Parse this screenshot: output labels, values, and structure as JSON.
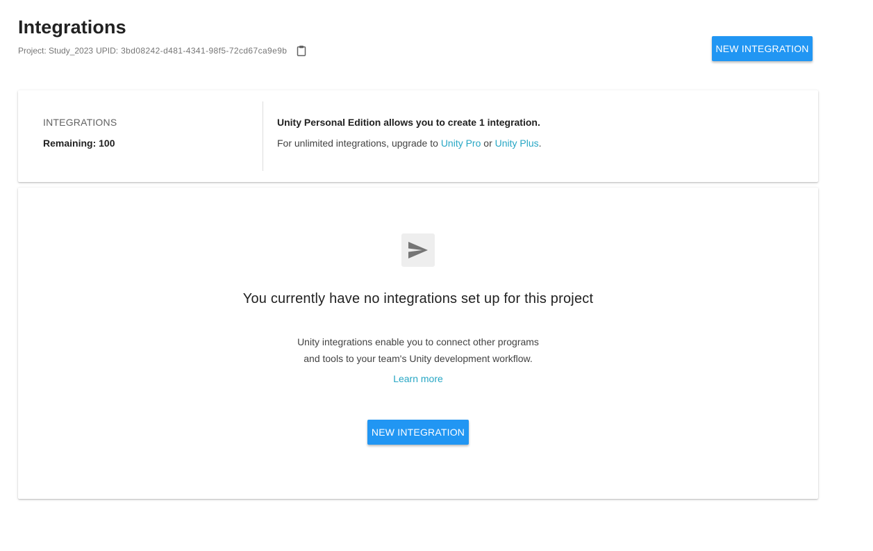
{
  "header": {
    "title": "Integrations",
    "project_label": "Project: Study_2023",
    "upid_label": "UPID:",
    "upid_value": "3bd08242-d481-4341-98f5-72cd67ca9e9b",
    "copy_icon": "clipboard-icon",
    "new_integration_label": "NEW INTEGRATION"
  },
  "summary": {
    "label": "INTEGRATIONS",
    "remaining": "Remaining: 100",
    "edition_text": "Unity Personal Edition allows you to create 1 integration.",
    "upgrade_prefix": "For unlimited integrations, upgrade to",
    "upgrade_pro": "Unity Pro",
    "upgrade_or": "or",
    "upgrade_plus": "Unity Plus",
    "upgrade_suffix": "."
  },
  "empty_state": {
    "icon": "send-icon",
    "title": "You currently have no integrations set up for this project",
    "description_line1": "Unity integrations enable you to connect other programs",
    "description_line2": "and tools to your team's Unity development workflow.",
    "learn_more": "Learn more",
    "new_integration_label": "NEW INTEGRATION"
  },
  "colors": {
    "primary_button": "#2196f3",
    "link": "#26a6c4",
    "title_text": "#212121",
    "muted_text": "#757575"
  }
}
